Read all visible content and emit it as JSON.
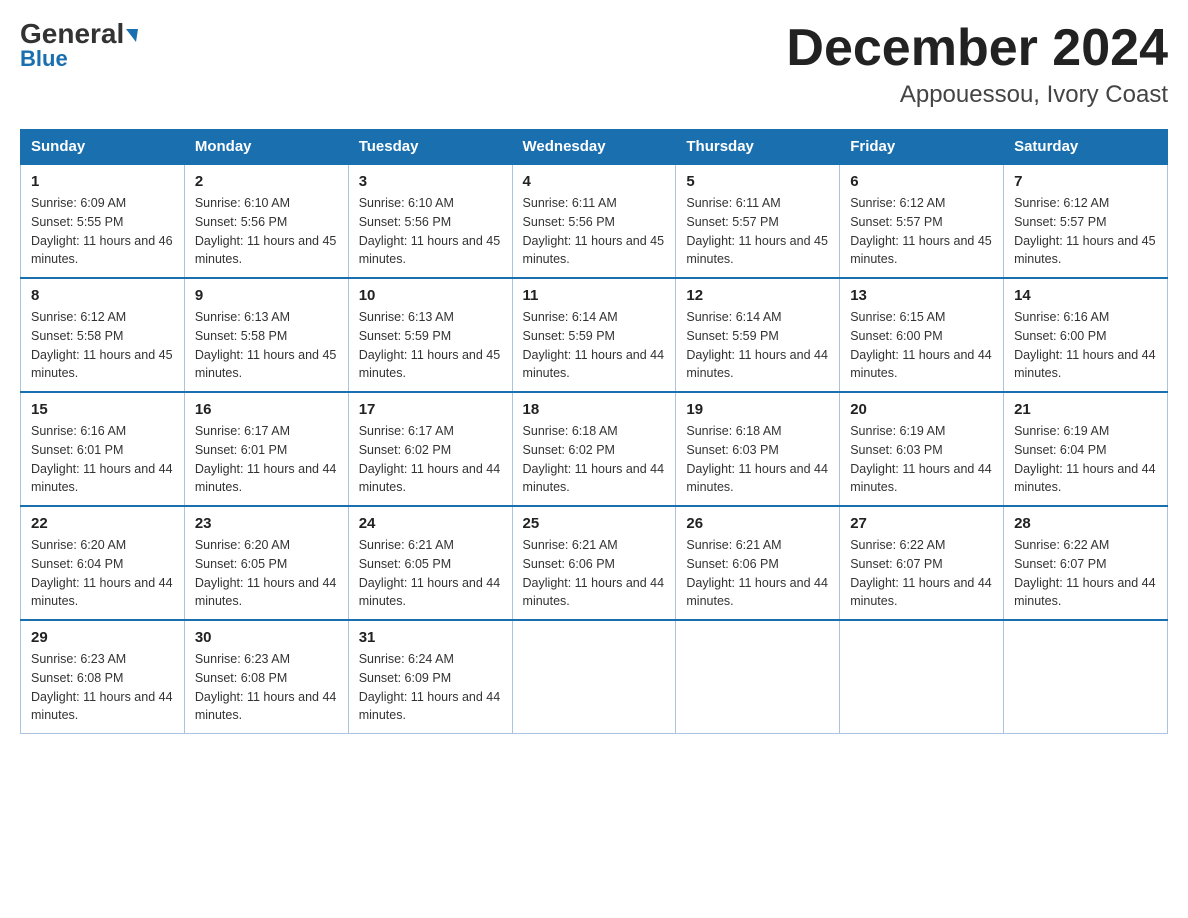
{
  "header": {
    "logo_general": "General",
    "logo_blue": "Blue",
    "month_title": "December 2024",
    "location": "Appouessou, Ivory Coast"
  },
  "weekdays": [
    "Sunday",
    "Monday",
    "Tuesday",
    "Wednesday",
    "Thursday",
    "Friday",
    "Saturday"
  ],
  "weeks": [
    [
      {
        "day": "1",
        "sunrise": "6:09 AM",
        "sunset": "5:55 PM",
        "daylight": "11 hours and 46 minutes."
      },
      {
        "day": "2",
        "sunrise": "6:10 AM",
        "sunset": "5:56 PM",
        "daylight": "11 hours and 45 minutes."
      },
      {
        "day": "3",
        "sunrise": "6:10 AM",
        "sunset": "5:56 PM",
        "daylight": "11 hours and 45 minutes."
      },
      {
        "day": "4",
        "sunrise": "6:11 AM",
        "sunset": "5:56 PM",
        "daylight": "11 hours and 45 minutes."
      },
      {
        "day": "5",
        "sunrise": "6:11 AM",
        "sunset": "5:57 PM",
        "daylight": "11 hours and 45 minutes."
      },
      {
        "day": "6",
        "sunrise": "6:12 AM",
        "sunset": "5:57 PM",
        "daylight": "11 hours and 45 minutes."
      },
      {
        "day": "7",
        "sunrise": "6:12 AM",
        "sunset": "5:57 PM",
        "daylight": "11 hours and 45 minutes."
      }
    ],
    [
      {
        "day": "8",
        "sunrise": "6:12 AM",
        "sunset": "5:58 PM",
        "daylight": "11 hours and 45 minutes."
      },
      {
        "day": "9",
        "sunrise": "6:13 AM",
        "sunset": "5:58 PM",
        "daylight": "11 hours and 45 minutes."
      },
      {
        "day": "10",
        "sunrise": "6:13 AM",
        "sunset": "5:59 PM",
        "daylight": "11 hours and 45 minutes."
      },
      {
        "day": "11",
        "sunrise": "6:14 AM",
        "sunset": "5:59 PM",
        "daylight": "11 hours and 44 minutes."
      },
      {
        "day": "12",
        "sunrise": "6:14 AM",
        "sunset": "5:59 PM",
        "daylight": "11 hours and 44 minutes."
      },
      {
        "day": "13",
        "sunrise": "6:15 AM",
        "sunset": "6:00 PM",
        "daylight": "11 hours and 44 minutes."
      },
      {
        "day": "14",
        "sunrise": "6:16 AM",
        "sunset": "6:00 PM",
        "daylight": "11 hours and 44 minutes."
      }
    ],
    [
      {
        "day": "15",
        "sunrise": "6:16 AM",
        "sunset": "6:01 PM",
        "daylight": "11 hours and 44 minutes."
      },
      {
        "day": "16",
        "sunrise": "6:17 AM",
        "sunset": "6:01 PM",
        "daylight": "11 hours and 44 minutes."
      },
      {
        "day": "17",
        "sunrise": "6:17 AM",
        "sunset": "6:02 PM",
        "daylight": "11 hours and 44 minutes."
      },
      {
        "day": "18",
        "sunrise": "6:18 AM",
        "sunset": "6:02 PM",
        "daylight": "11 hours and 44 minutes."
      },
      {
        "day": "19",
        "sunrise": "6:18 AM",
        "sunset": "6:03 PM",
        "daylight": "11 hours and 44 minutes."
      },
      {
        "day": "20",
        "sunrise": "6:19 AM",
        "sunset": "6:03 PM",
        "daylight": "11 hours and 44 minutes."
      },
      {
        "day": "21",
        "sunrise": "6:19 AM",
        "sunset": "6:04 PM",
        "daylight": "11 hours and 44 minutes."
      }
    ],
    [
      {
        "day": "22",
        "sunrise": "6:20 AM",
        "sunset": "6:04 PM",
        "daylight": "11 hours and 44 minutes."
      },
      {
        "day": "23",
        "sunrise": "6:20 AM",
        "sunset": "6:05 PM",
        "daylight": "11 hours and 44 minutes."
      },
      {
        "day": "24",
        "sunrise": "6:21 AM",
        "sunset": "6:05 PM",
        "daylight": "11 hours and 44 minutes."
      },
      {
        "day": "25",
        "sunrise": "6:21 AM",
        "sunset": "6:06 PM",
        "daylight": "11 hours and 44 minutes."
      },
      {
        "day": "26",
        "sunrise": "6:21 AM",
        "sunset": "6:06 PM",
        "daylight": "11 hours and 44 minutes."
      },
      {
        "day": "27",
        "sunrise": "6:22 AM",
        "sunset": "6:07 PM",
        "daylight": "11 hours and 44 minutes."
      },
      {
        "day": "28",
        "sunrise": "6:22 AM",
        "sunset": "6:07 PM",
        "daylight": "11 hours and 44 minutes."
      }
    ],
    [
      {
        "day": "29",
        "sunrise": "6:23 AM",
        "sunset": "6:08 PM",
        "daylight": "11 hours and 44 minutes."
      },
      {
        "day": "30",
        "sunrise": "6:23 AM",
        "sunset": "6:08 PM",
        "daylight": "11 hours and 44 minutes."
      },
      {
        "day": "31",
        "sunrise": "6:24 AM",
        "sunset": "6:09 PM",
        "daylight": "11 hours and 44 minutes."
      },
      null,
      null,
      null,
      null
    ]
  ]
}
